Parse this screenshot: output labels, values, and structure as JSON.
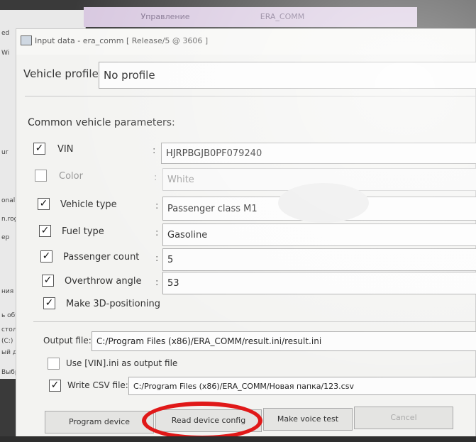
{
  "background_window": {
    "tabs": [
      "Управление",
      "ERA_COMM"
    ],
    "left_labels": [
      "ed",
      "Wi",
      "ur",
      "onal",
      "n.rogac",
      "ер",
      "ния",
      "ь объекты",
      "стол",
      "(C:)",
      "ый диск (D:",
      "Выбран"
    ]
  },
  "dialog": {
    "title": "Input data - era_comm [ Release/5 @ 3606 ]",
    "vehicle_profile": {
      "label": "Vehicle profile:",
      "value": "No profile"
    },
    "common_params_title": "Common vehicle parameters:",
    "params": [
      {
        "label": "VIN",
        "value": "HJRPBGJB0PF079240",
        "checked": true,
        "enabled": true
      },
      {
        "label": "Color",
        "value": "White",
        "checked": false,
        "enabled": false
      },
      {
        "label": "Vehicle type",
        "value": "Passenger class M1",
        "checked": true,
        "enabled": true
      },
      {
        "label": "Fuel type",
        "value": "Gasoline",
        "checked": true,
        "enabled": true
      },
      {
        "label": "Passenger count",
        "value": "5",
        "checked": true,
        "enabled": true
      },
      {
        "label": "Overthrow angle",
        "value": "53",
        "checked": true,
        "enabled": true
      }
    ],
    "make_3d": {
      "label": "Make 3D-positioning",
      "checked": true
    },
    "separator": ":",
    "check_mark": "✓",
    "output_file": {
      "label": "Output file:",
      "value": "C:/Program Files (x86)/ERA_COMM/result.ini/result.ini"
    },
    "use_vin": {
      "label": "Use [VIN].ini as output file",
      "checked": false
    },
    "write_csv": {
      "label": "Write CSV file:",
      "value": "C:/Program Files (x86)/ERA_COMM/Новая папка/123.csv",
      "checked": true
    },
    "buttons": {
      "program": "Program device",
      "read": "Read device config",
      "voice": "Make voice test",
      "cancel": "Cancel"
    }
  }
}
